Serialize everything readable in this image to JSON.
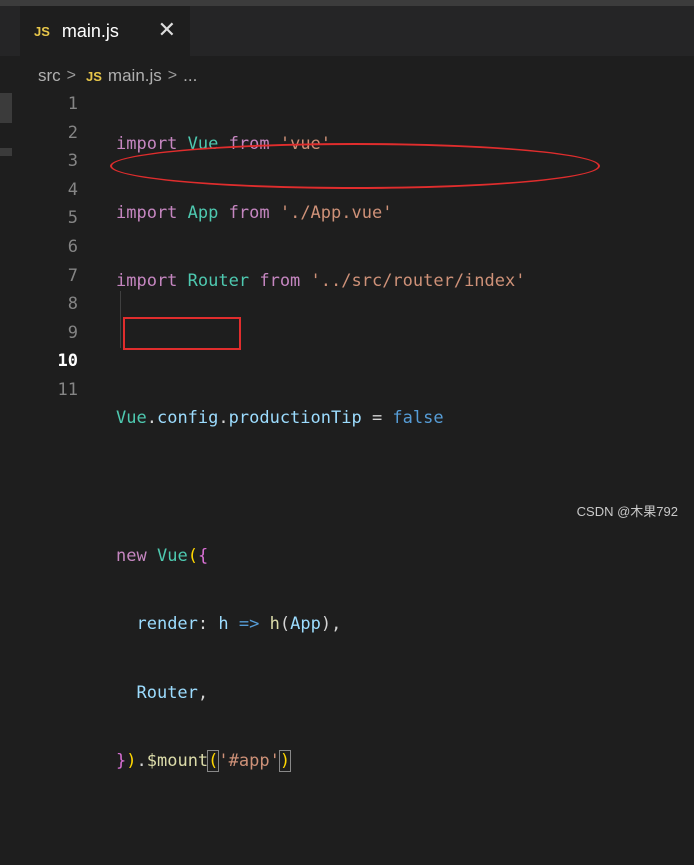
{
  "tab": {
    "badge": "JS",
    "label": "main.js",
    "close": "✕"
  },
  "breadcrumb": {
    "folder": "src",
    "sep": ">",
    "badge": "JS",
    "file": "main.js",
    "rest": "..."
  },
  "line_numbers": [
    "1",
    "2",
    "3",
    "4",
    "5",
    "6",
    "7",
    "8",
    "9",
    "10",
    "11"
  ],
  "code": {
    "l1": {
      "t1": "import",
      "t2": "Vue",
      "t3": "from",
      "t4": "'vue'"
    },
    "l2": {
      "t1": "import",
      "t2": "App",
      "t3": "from",
      "t4": "'./App.vue'"
    },
    "l3": {
      "t1": "import",
      "t2": "Router",
      "t3": "from",
      "t4": "'../src/router/index'"
    },
    "l5": {
      "t1": "Vue",
      "t2": ".",
      "t3": "config",
      "t4": ".",
      "t5": "productionTip",
      "t6": " = ",
      "t7": "false"
    },
    "l7": {
      "t1": "new",
      "t2": "Vue",
      "t3": "(",
      "t4": "{"
    },
    "l8": {
      "t1": "render",
      "t2": ": ",
      "t3": "h",
      "t4": " => ",
      "t5": "h",
      "t6": "(",
      "t7": "App",
      "t8": ")",
      "t9": ","
    },
    "l9": {
      "t1": "Router",
      "t2": ","
    },
    "l10": {
      "t1": "}",
      "t2": ")",
      "t3": ".",
      "t4": "$mount",
      "t5": "(",
      "t6": "'#app'",
      "t7": ")"
    }
  },
  "watermark": "CSDN @木果792",
  "colors": {
    "keyword": "#c586c0",
    "class": "#4ec9b0",
    "string": "#ce9178",
    "annotation": "#e02d2d"
  }
}
